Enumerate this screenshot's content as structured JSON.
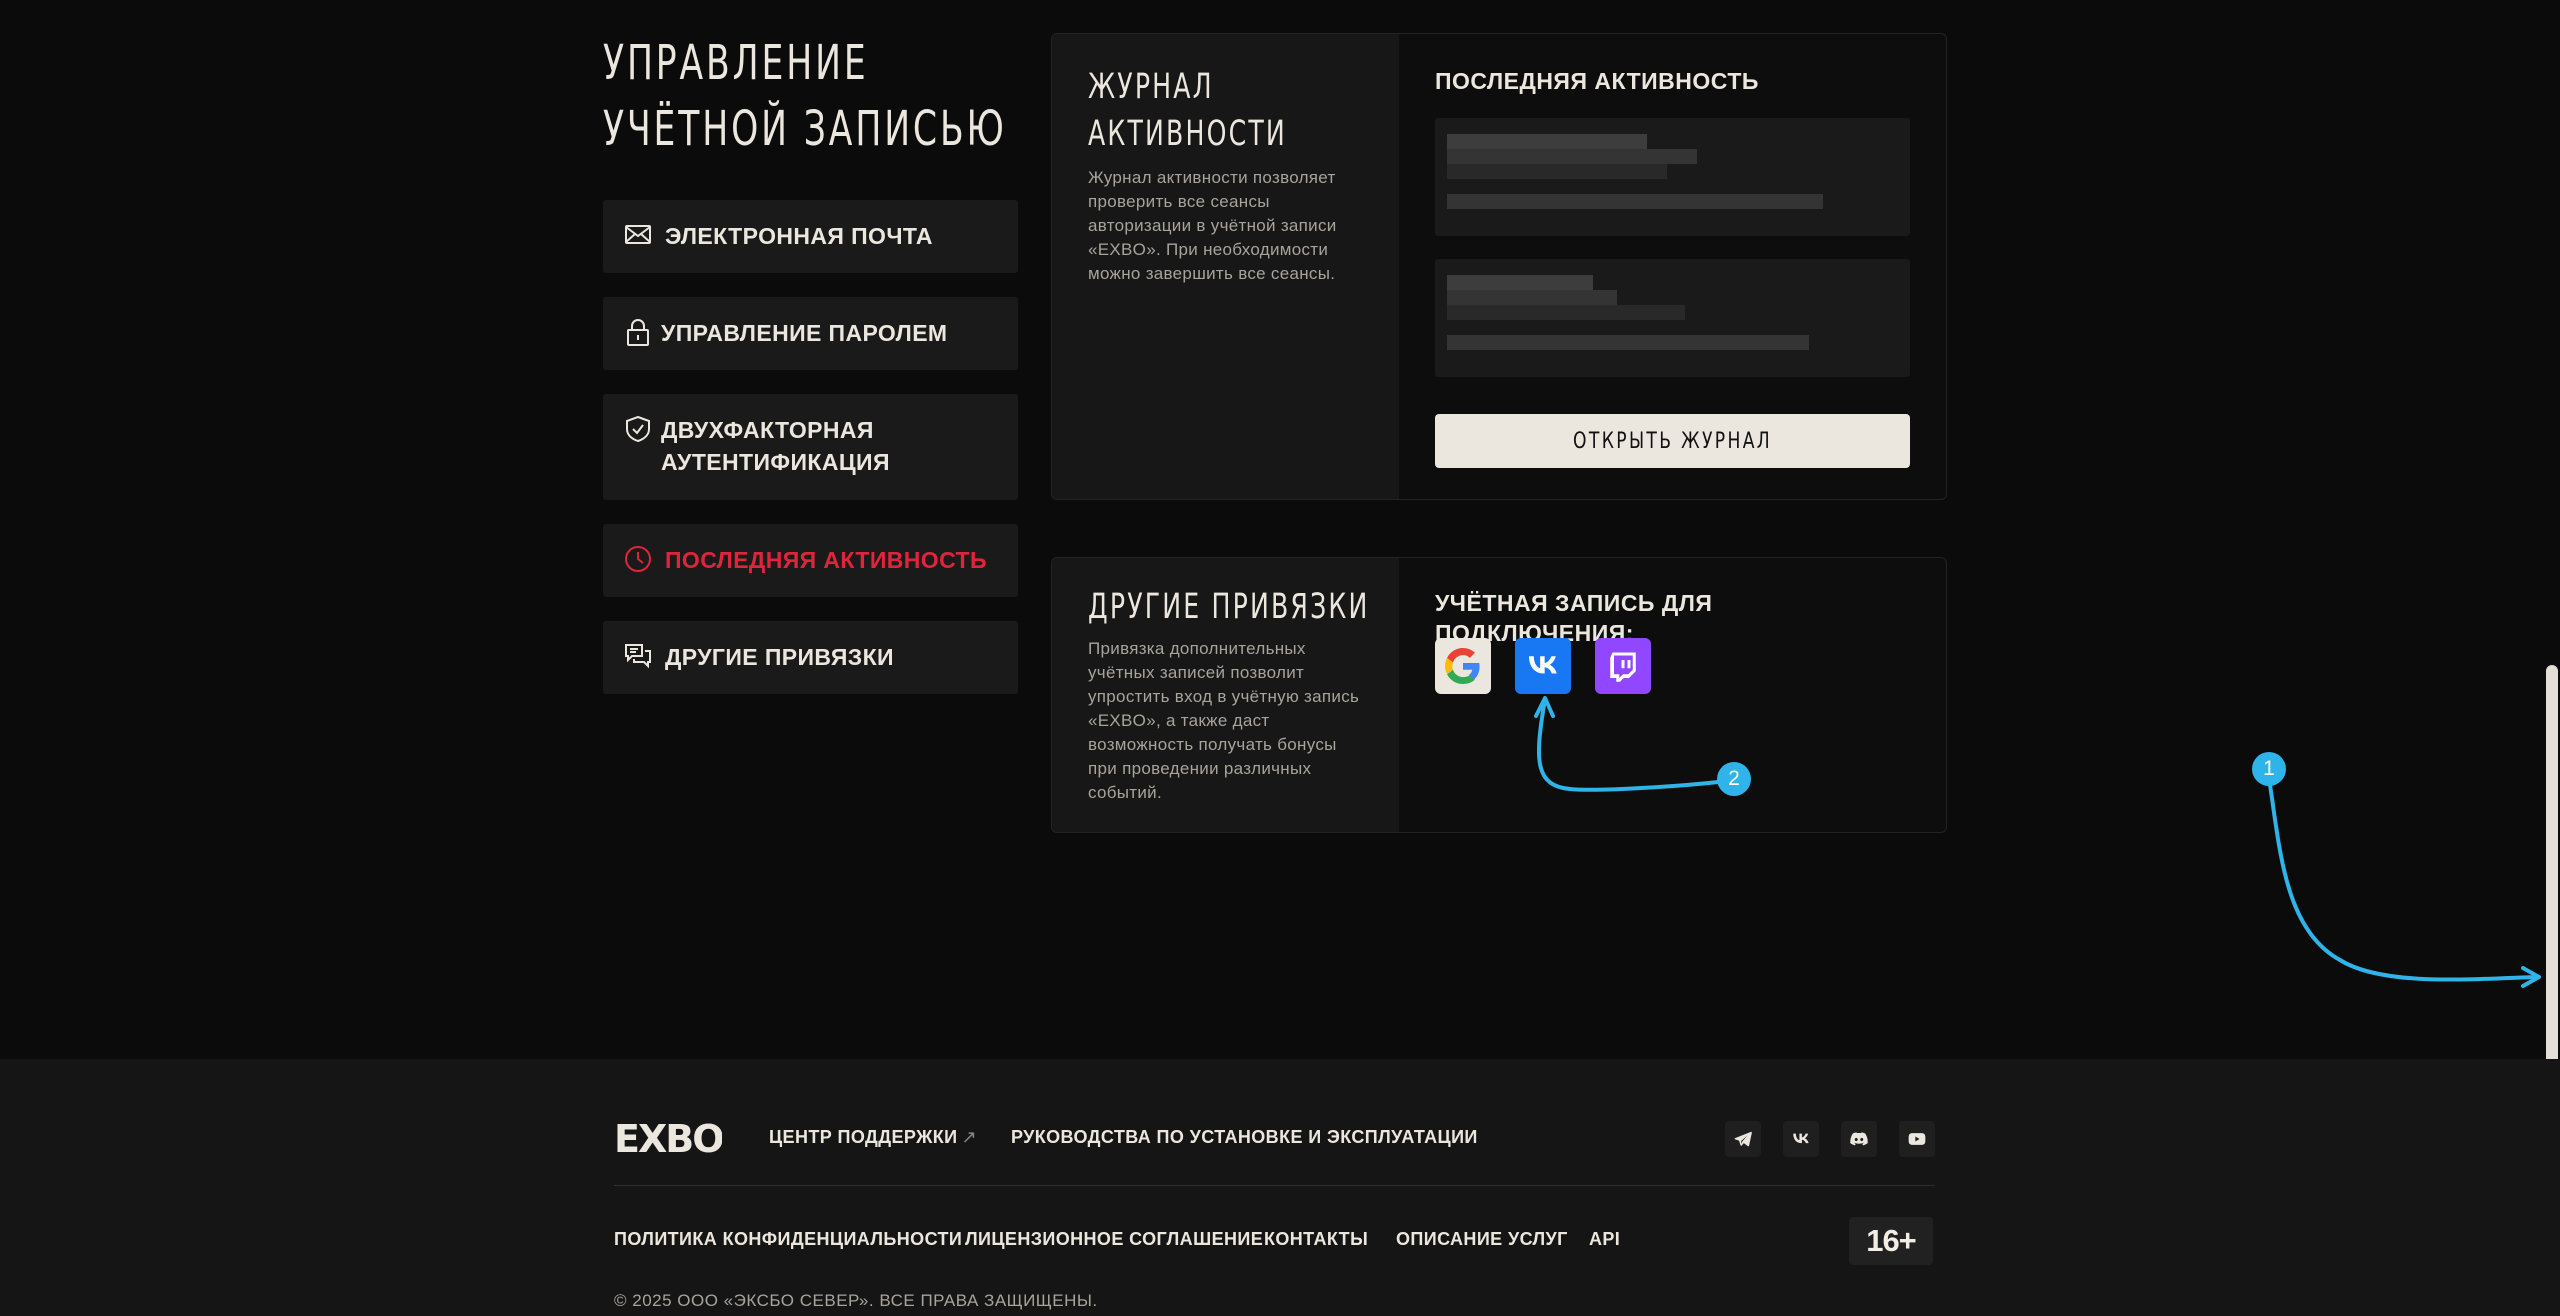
{
  "sidebar": {
    "title_line1": "УПРАВЛЕНИЕ",
    "title_line2": "УЧЁТНОЙ ЗАПИСЬЮ",
    "items": [
      {
        "label": "ЭЛЕКТРОННАЯ ПОЧТА",
        "icon": "mail-icon"
      },
      {
        "label": "УПРАВЛЕНИЕ ПАРОЛЕМ",
        "icon": "lock-icon"
      },
      {
        "label_line1": "ДВУХФАКТОРНАЯ",
        "label_line2": "АУТЕНТИФИКАЦИЯ",
        "icon": "shield-check-icon"
      },
      {
        "label": "ПОСЛЕДНЯЯ АКТИВНОСТЬ",
        "icon": "clock-icon",
        "active": true
      },
      {
        "label": "ДРУГИЕ ПРИВЯЗКИ",
        "icon": "chat-icon"
      }
    ]
  },
  "activity_card": {
    "title_line1": "ЖУРНАЛ",
    "title_line2": "АКТИВНОСТИ",
    "description": "Журнал активности позволяет проверить все сеансы авторизации в учётной записи «EXBO». При необходимости можно завершить все сеансы.",
    "heading": "ПОСЛЕДНЯЯ АКТИВНОСТЬ",
    "button": "ОТКРЫТЬ ЖУРНАЛ"
  },
  "links_card": {
    "title": "ДРУГИЕ ПРИВЯЗКИ",
    "description": "Привязка дополнительных учётных записей позволит упростить вход в учётную запись «EXBO», а также даст возможность получать бонусы при проведении различных событий.",
    "heading": "УЧЁТНАЯ ЗАПИСЬ ДЛЯ ПОДКЛЮЧЕНИЯ:",
    "providers": [
      "google-icon",
      "vk-icon",
      "twitch-icon"
    ]
  },
  "annotations": {
    "badge1": "1",
    "badge2": "2"
  },
  "footer": {
    "logo": "EXBO",
    "support_link": "ЦЕНТР ПОДДЕРЖКИ",
    "support_ext": "↗",
    "guides_link": "РУКОВОДСТВА ПО УСТАНОВКЕ И ЭКСПЛУАТАЦИИ",
    "social": [
      "telegram-icon",
      "vk-icon",
      "discord-icon",
      "youtube-icon"
    ],
    "bottom_links": [
      "ПОЛИТИКА КОНФИДЕНЦИАЛЬНОСТИ",
      "ЛИЦЕНЗИОННОЕ СОГЛАШЕНИЕ",
      "КОНТАКТЫ",
      "ОПИСАНИЕ УСЛУГ",
      "API"
    ],
    "age_rating": "16+",
    "copyright": "© 2025 ООО «ЭКСБО СЕВЕР». ВСЕ ПРАВА ЗАЩИЩЕНЫ."
  },
  "colors": {
    "background": "#0b0b0b",
    "accent_red": "#e0243b",
    "annotation_blue": "#2fb4ea",
    "button_light": "#ece7de"
  }
}
